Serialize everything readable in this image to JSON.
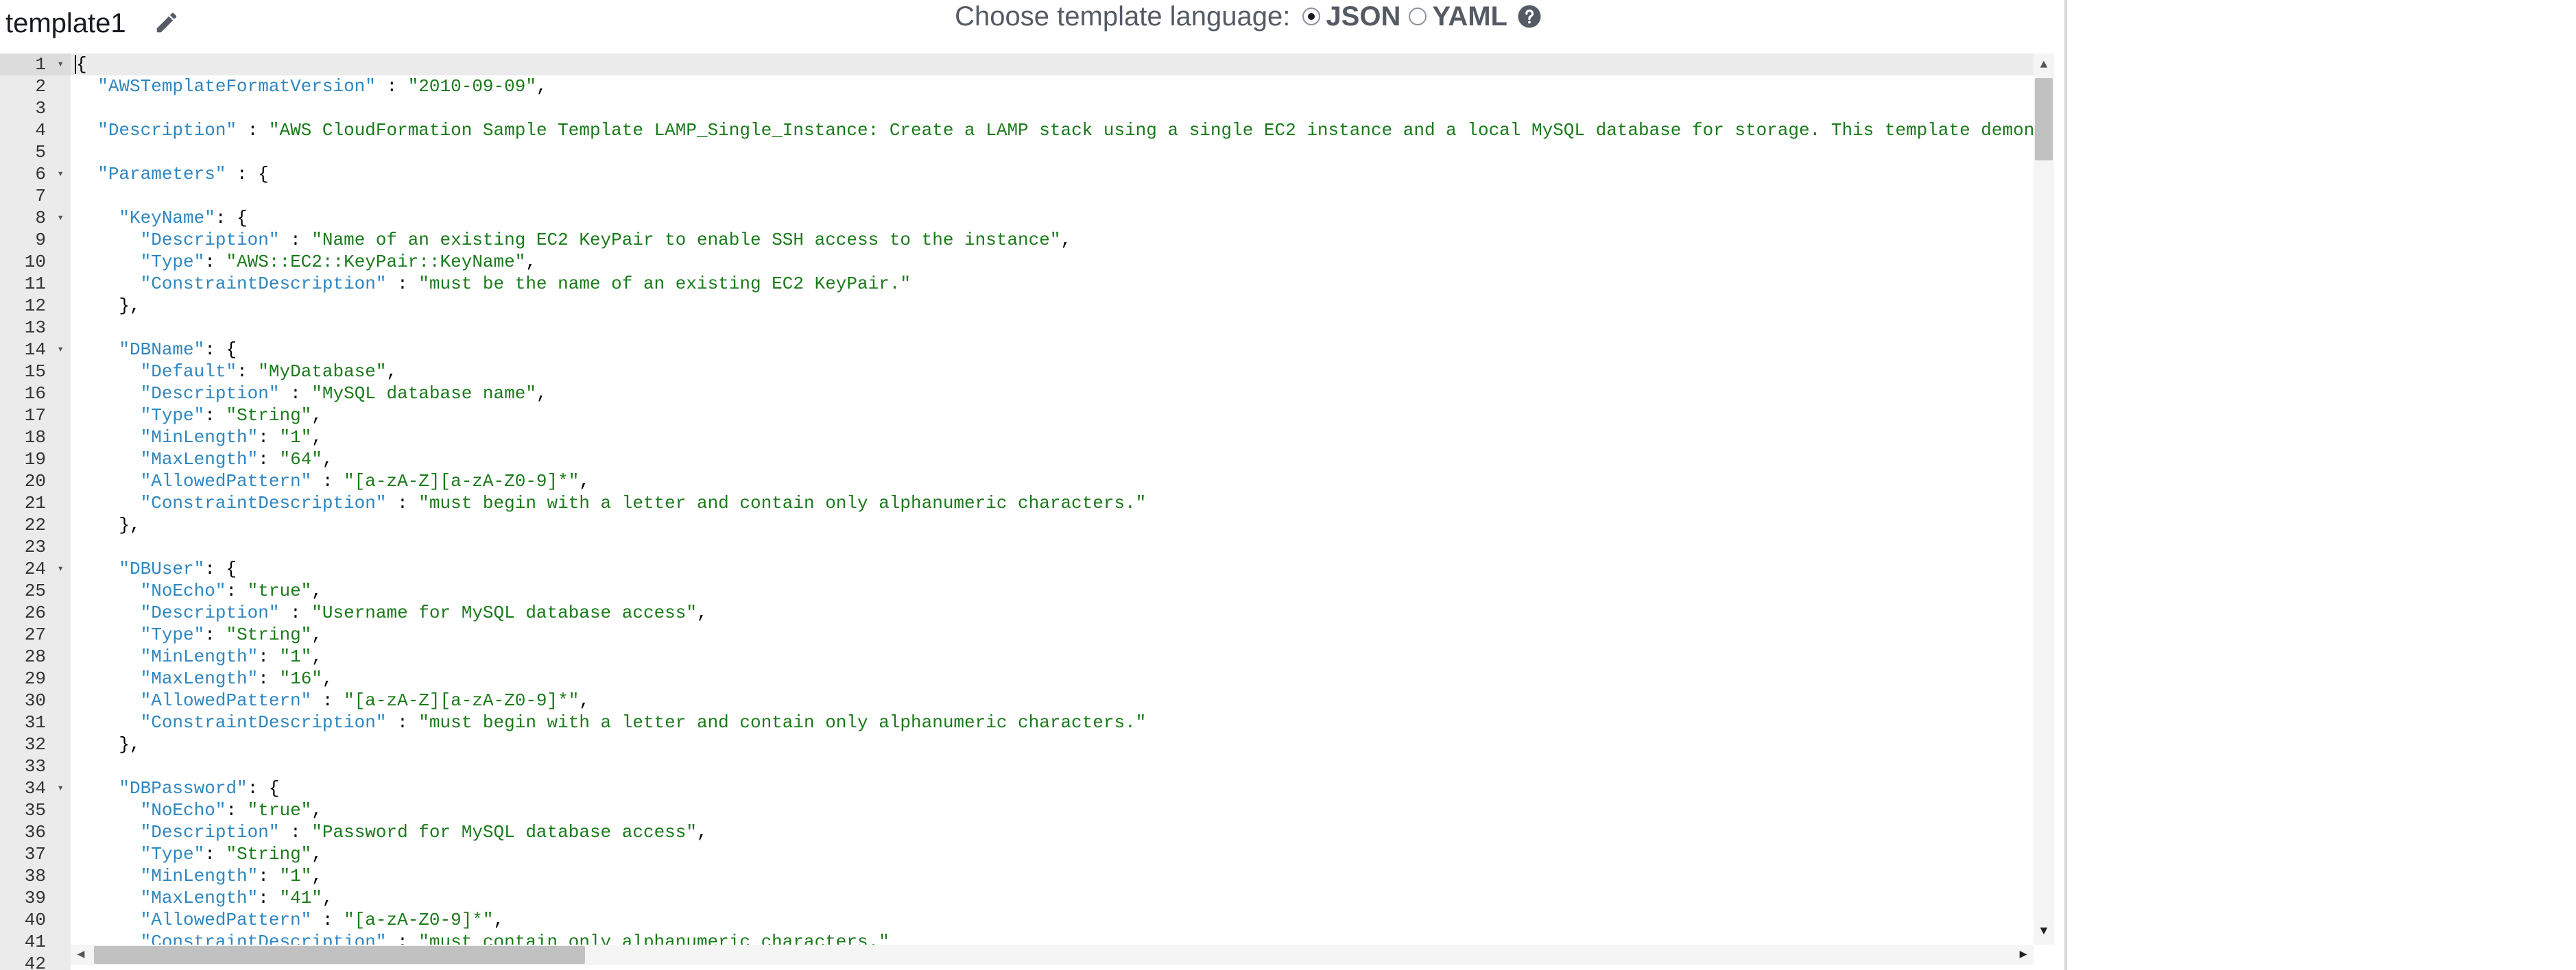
{
  "template": {
    "name": "template1"
  },
  "language": {
    "label": "Choose template language:",
    "options": [
      "JSON",
      "YAML"
    ],
    "selected": "JSON"
  },
  "editor": {
    "lines": [
      {
        "n": "1",
        "fold": true,
        "parts": [
          [
            "p",
            "{"
          ]
        ]
      },
      {
        "n": "2",
        "parts": [
          [
            "p",
            "  "
          ],
          [
            "k",
            "\"AWSTemplateFormatVersion\""
          ],
          [
            "p",
            " : "
          ],
          [
            "s",
            "\"2010-09-09\""
          ],
          [
            "p",
            ","
          ]
        ]
      },
      {
        "n": "3",
        "parts": []
      },
      {
        "n": "4",
        "parts": [
          [
            "p",
            "  "
          ],
          [
            "k",
            "\"Description\""
          ],
          [
            "p",
            " : "
          ],
          [
            "s",
            "\"AWS CloudFormation Sample Template LAMP_Single_Instance: Create a LAMP stack using a single EC2 instance and a local MySQL database for storage. This template demonstrates u"
          ]
        ]
      },
      {
        "n": "5",
        "parts": []
      },
      {
        "n": "6",
        "fold": true,
        "parts": [
          [
            "p",
            "  "
          ],
          [
            "k",
            "\"Parameters\""
          ],
          [
            "p",
            " : {"
          ]
        ]
      },
      {
        "n": "7",
        "parts": []
      },
      {
        "n": "8",
        "fold": true,
        "parts": [
          [
            "p",
            "    "
          ],
          [
            "k",
            "\"KeyName\""
          ],
          [
            "p",
            ": {"
          ]
        ]
      },
      {
        "n": "9",
        "parts": [
          [
            "p",
            "      "
          ],
          [
            "k",
            "\"Description\""
          ],
          [
            "p",
            " : "
          ],
          [
            "s",
            "\"Name of an existing EC2 KeyPair to enable SSH access to the instance\""
          ],
          [
            "p",
            ","
          ]
        ]
      },
      {
        "n": "10",
        "parts": [
          [
            "p",
            "      "
          ],
          [
            "k",
            "\"Type\""
          ],
          [
            "p",
            ": "
          ],
          [
            "s",
            "\"AWS::EC2::KeyPair::KeyName\""
          ],
          [
            "p",
            ","
          ]
        ]
      },
      {
        "n": "11",
        "parts": [
          [
            "p",
            "      "
          ],
          [
            "k",
            "\"ConstraintDescription\""
          ],
          [
            "p",
            " : "
          ],
          [
            "s",
            "\"must be the name of an existing EC2 KeyPair.\""
          ]
        ]
      },
      {
        "n": "12",
        "parts": [
          [
            "p",
            "    },"
          ]
        ]
      },
      {
        "n": "13",
        "parts": []
      },
      {
        "n": "14",
        "fold": true,
        "parts": [
          [
            "p",
            "    "
          ],
          [
            "k",
            "\"DBName\""
          ],
          [
            "p",
            ": {"
          ]
        ]
      },
      {
        "n": "15",
        "parts": [
          [
            "p",
            "      "
          ],
          [
            "k",
            "\"Default\""
          ],
          [
            "p",
            ": "
          ],
          [
            "s",
            "\"MyDatabase\""
          ],
          [
            "p",
            ","
          ]
        ]
      },
      {
        "n": "16",
        "parts": [
          [
            "p",
            "      "
          ],
          [
            "k",
            "\"Description\""
          ],
          [
            "p",
            " : "
          ],
          [
            "s",
            "\"MySQL database name\""
          ],
          [
            "p",
            ","
          ]
        ]
      },
      {
        "n": "17",
        "parts": [
          [
            "p",
            "      "
          ],
          [
            "k",
            "\"Type\""
          ],
          [
            "p",
            ": "
          ],
          [
            "s",
            "\"String\""
          ],
          [
            "p",
            ","
          ]
        ]
      },
      {
        "n": "18",
        "parts": [
          [
            "p",
            "      "
          ],
          [
            "k",
            "\"MinLength\""
          ],
          [
            "p",
            ": "
          ],
          [
            "s",
            "\"1\""
          ],
          [
            "p",
            ","
          ]
        ]
      },
      {
        "n": "19",
        "parts": [
          [
            "p",
            "      "
          ],
          [
            "k",
            "\"MaxLength\""
          ],
          [
            "p",
            ": "
          ],
          [
            "s",
            "\"64\""
          ],
          [
            "p",
            ","
          ]
        ]
      },
      {
        "n": "20",
        "parts": [
          [
            "p",
            "      "
          ],
          [
            "k",
            "\"AllowedPattern\""
          ],
          [
            "p",
            " : "
          ],
          [
            "s",
            "\"[a-zA-Z][a-zA-Z0-9]*\""
          ],
          [
            "p",
            ","
          ]
        ]
      },
      {
        "n": "21",
        "parts": [
          [
            "p",
            "      "
          ],
          [
            "k",
            "\"ConstraintDescription\""
          ],
          [
            "p",
            " : "
          ],
          [
            "s",
            "\"must begin with a letter and contain only alphanumeric characters.\""
          ]
        ]
      },
      {
        "n": "22",
        "parts": [
          [
            "p",
            "    },"
          ]
        ]
      },
      {
        "n": "23",
        "parts": []
      },
      {
        "n": "24",
        "fold": true,
        "parts": [
          [
            "p",
            "    "
          ],
          [
            "k",
            "\"DBUser\""
          ],
          [
            "p",
            ": {"
          ]
        ]
      },
      {
        "n": "25",
        "parts": [
          [
            "p",
            "      "
          ],
          [
            "k",
            "\"NoEcho\""
          ],
          [
            "p",
            ": "
          ],
          [
            "s",
            "\"true\""
          ],
          [
            "p",
            ","
          ]
        ]
      },
      {
        "n": "26",
        "parts": [
          [
            "p",
            "      "
          ],
          [
            "k",
            "\"Description\""
          ],
          [
            "p",
            " : "
          ],
          [
            "s",
            "\"Username for MySQL database access\""
          ],
          [
            "p",
            ","
          ]
        ]
      },
      {
        "n": "27",
        "parts": [
          [
            "p",
            "      "
          ],
          [
            "k",
            "\"Type\""
          ],
          [
            "p",
            ": "
          ],
          [
            "s",
            "\"String\""
          ],
          [
            "p",
            ","
          ]
        ]
      },
      {
        "n": "28",
        "parts": [
          [
            "p",
            "      "
          ],
          [
            "k",
            "\"MinLength\""
          ],
          [
            "p",
            ": "
          ],
          [
            "s",
            "\"1\""
          ],
          [
            "p",
            ","
          ]
        ]
      },
      {
        "n": "29",
        "parts": [
          [
            "p",
            "      "
          ],
          [
            "k",
            "\"MaxLength\""
          ],
          [
            "p",
            ": "
          ],
          [
            "s",
            "\"16\""
          ],
          [
            "p",
            ","
          ]
        ]
      },
      {
        "n": "30",
        "parts": [
          [
            "p",
            "      "
          ],
          [
            "k",
            "\"AllowedPattern\""
          ],
          [
            "p",
            " : "
          ],
          [
            "s",
            "\"[a-zA-Z][a-zA-Z0-9]*\""
          ],
          [
            "p",
            ","
          ]
        ]
      },
      {
        "n": "31",
        "parts": [
          [
            "p",
            "      "
          ],
          [
            "k",
            "\"ConstraintDescription\""
          ],
          [
            "p",
            " : "
          ],
          [
            "s",
            "\"must begin with a letter and contain only alphanumeric characters.\""
          ]
        ]
      },
      {
        "n": "32",
        "parts": [
          [
            "p",
            "    },"
          ]
        ]
      },
      {
        "n": "33",
        "parts": []
      },
      {
        "n": "34",
        "fold": true,
        "parts": [
          [
            "p",
            "    "
          ],
          [
            "k",
            "\"DBPassword\""
          ],
          [
            "p",
            ": {"
          ]
        ]
      },
      {
        "n": "35",
        "parts": [
          [
            "p",
            "      "
          ],
          [
            "k",
            "\"NoEcho\""
          ],
          [
            "p",
            ": "
          ],
          [
            "s",
            "\"true\""
          ],
          [
            "p",
            ","
          ]
        ]
      },
      {
        "n": "36",
        "parts": [
          [
            "p",
            "      "
          ],
          [
            "k",
            "\"Description\""
          ],
          [
            "p",
            " : "
          ],
          [
            "s",
            "\"Password for MySQL database access\""
          ],
          [
            "p",
            ","
          ]
        ]
      },
      {
        "n": "37",
        "parts": [
          [
            "p",
            "      "
          ],
          [
            "k",
            "\"Type\""
          ],
          [
            "p",
            ": "
          ],
          [
            "s",
            "\"String\""
          ],
          [
            "p",
            ","
          ]
        ]
      },
      {
        "n": "38",
        "parts": [
          [
            "p",
            "      "
          ],
          [
            "k",
            "\"MinLength\""
          ],
          [
            "p",
            ": "
          ],
          [
            "s",
            "\"1\""
          ],
          [
            "p",
            ","
          ]
        ]
      },
      {
        "n": "39",
        "parts": [
          [
            "p",
            "      "
          ],
          [
            "k",
            "\"MaxLength\""
          ],
          [
            "p",
            ": "
          ],
          [
            "s",
            "\"41\""
          ],
          [
            "p",
            ","
          ]
        ]
      },
      {
        "n": "40",
        "parts": [
          [
            "p",
            "      "
          ],
          [
            "k",
            "\"AllowedPattern\""
          ],
          [
            "p",
            " : "
          ],
          [
            "s",
            "\"[a-zA-Z0-9]*\""
          ],
          [
            "p",
            ","
          ]
        ]
      },
      {
        "n": "41",
        "parts": [
          [
            "p",
            "      "
          ],
          [
            "k",
            "\"ConstraintDescription\""
          ],
          [
            "p",
            " : "
          ],
          [
            "s",
            "\"must contain only alphanumeric characters.\""
          ]
        ]
      },
      {
        "n": "42",
        "parts": []
      }
    ]
  },
  "icons": {
    "edit": "pencil-icon",
    "help": "help-icon",
    "fold": "fold-arrow-icon"
  },
  "colors": {
    "key": "#2e86c1",
    "string": "#1a7a1a",
    "gutter": "#ebebeb"
  }
}
